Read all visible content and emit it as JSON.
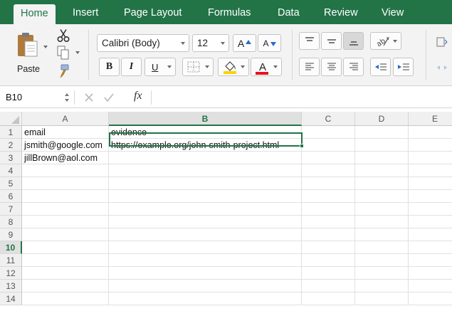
{
  "ribbon": {
    "tabs": [
      {
        "id": "home",
        "label": "Home",
        "active": true
      },
      {
        "id": "insert",
        "label": "Insert"
      },
      {
        "id": "page-layout",
        "label": "Page Layout"
      },
      {
        "id": "formulas",
        "label": "Formulas"
      },
      {
        "id": "data",
        "label": "Data"
      },
      {
        "id": "review",
        "label": "Review"
      },
      {
        "id": "view",
        "label": "View"
      }
    ],
    "paste_label": "Paste",
    "font_name": "Calibri (Body)",
    "font_size": "12",
    "grow_font": "A",
    "shrink_font": "A",
    "bold": "B",
    "italic": "I",
    "underline": "U",
    "font_color_glyph": "A",
    "accent_color": "#227447",
    "fill_color": "#ffd200",
    "font_color": "#e81123"
  },
  "formula_bar": {
    "name_box": "B10",
    "fx": "fx",
    "content": ""
  },
  "grid": {
    "columns": [
      "A",
      "B",
      "C",
      "D",
      "E"
    ],
    "selected_column": "B",
    "selected_row": "10",
    "rows": [
      {
        "n": "1",
        "A": "email",
        "B": "evidence"
      },
      {
        "n": "2",
        "A": "jsmith@google.com",
        "B": "https://example.org/john-smith-project.html"
      },
      {
        "n": "3",
        "A": "jillBrown@aol.com",
        "B": ""
      },
      {
        "n": "4"
      },
      {
        "n": "5"
      },
      {
        "n": "6"
      },
      {
        "n": "7"
      },
      {
        "n": "8"
      },
      {
        "n": "9"
      },
      {
        "n": "10"
      },
      {
        "n": "11"
      },
      {
        "n": "12"
      },
      {
        "n": "13"
      },
      {
        "n": "14"
      }
    ]
  }
}
